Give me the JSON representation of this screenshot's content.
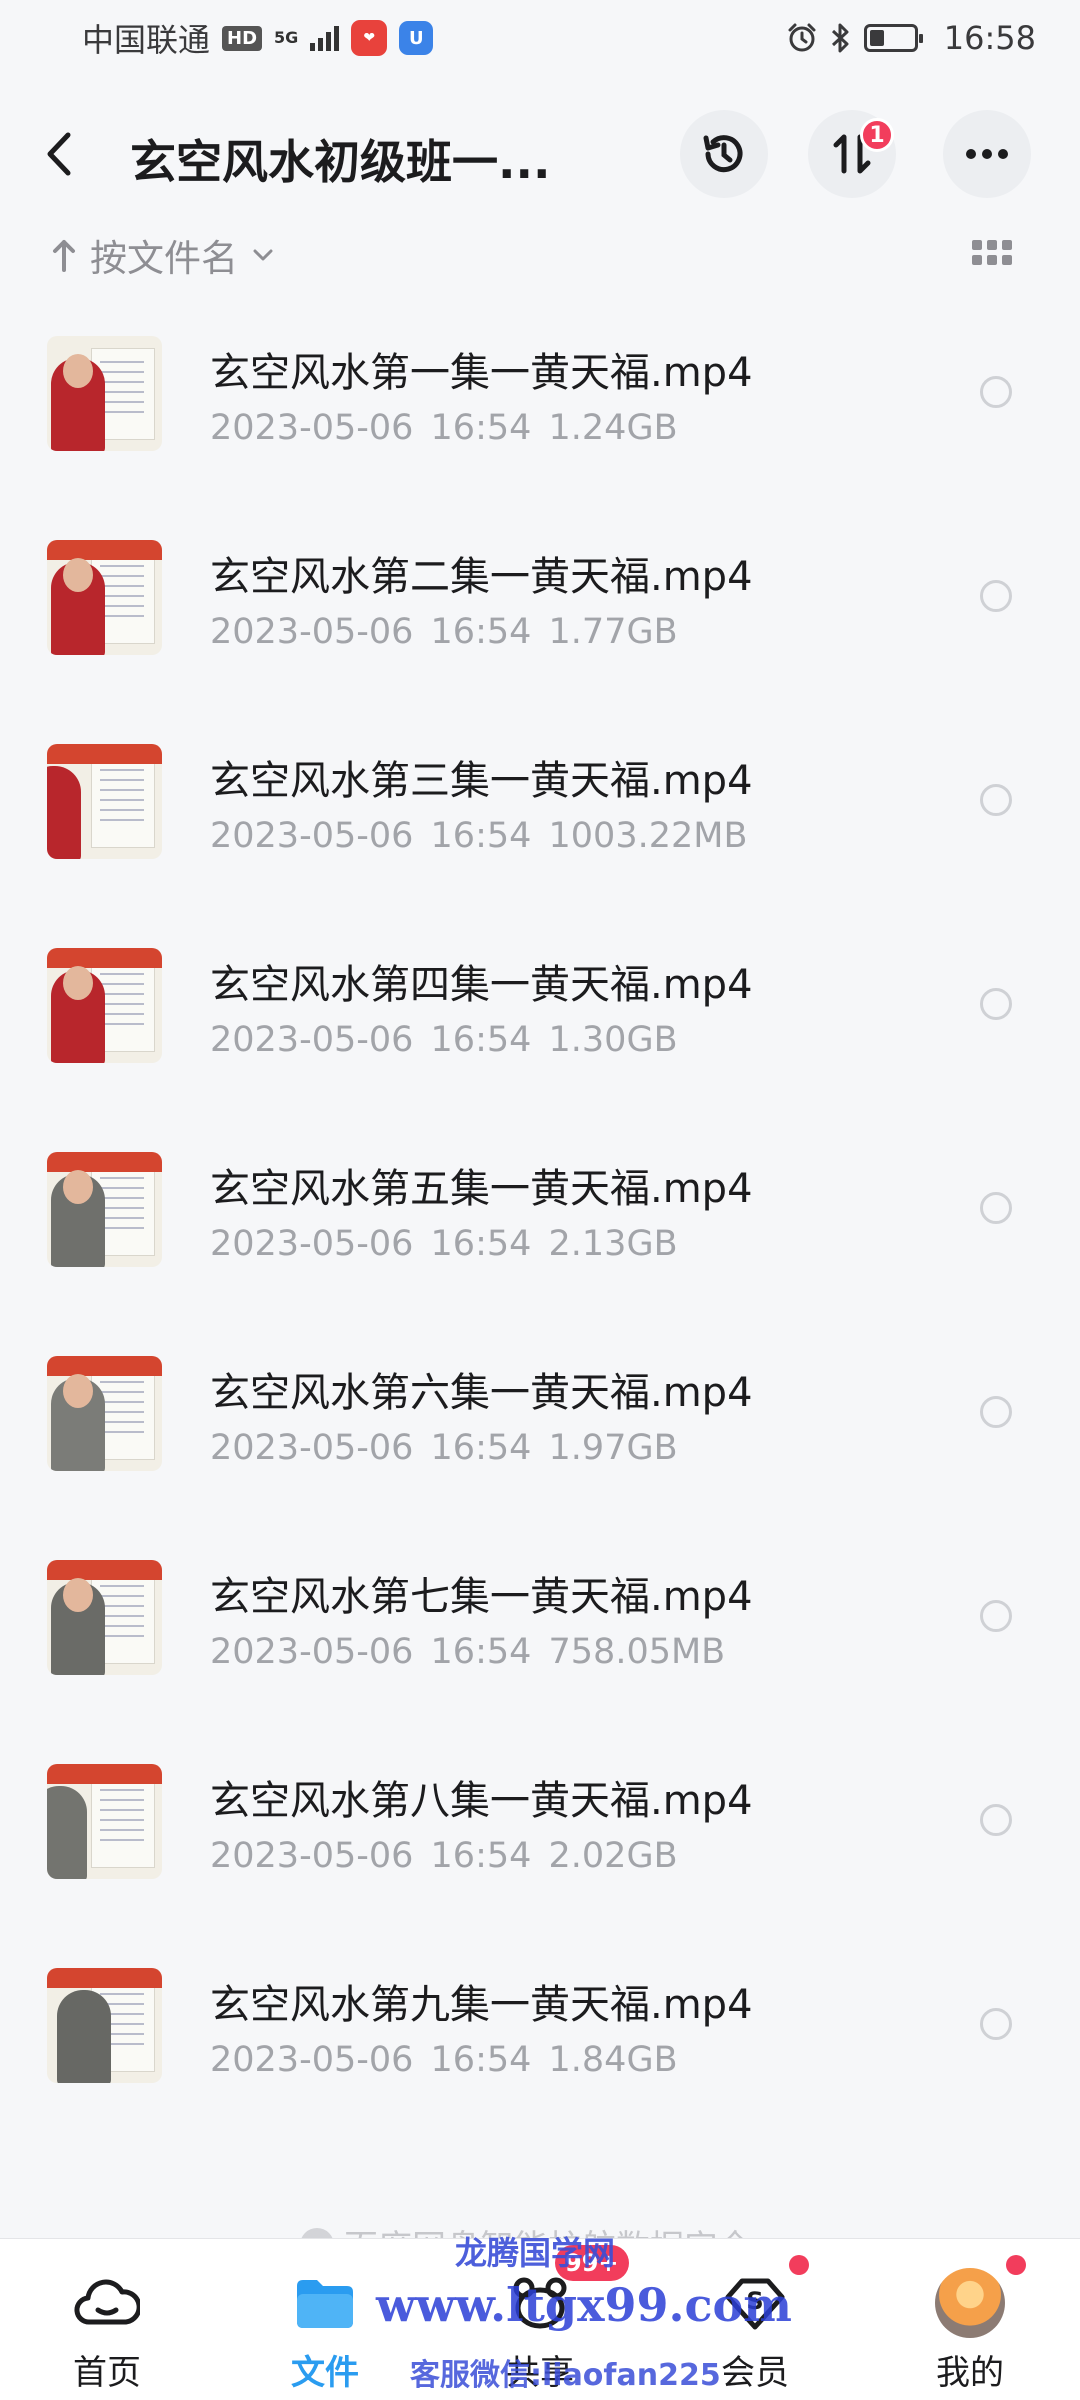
{
  "status_bar": {
    "carrier": "中国联通",
    "hd": "HD",
    "network": "5G",
    "time": "16:58"
  },
  "header": {
    "title": "玄空风水初级班一...",
    "transfer_badge": "1"
  },
  "sort": {
    "label": "按文件名"
  },
  "files": [
    {
      "name": "玄空风水第一集一黄天福.mp4",
      "meta": "2023-05-06  16:54  1.24GB"
    },
    {
      "name": "玄空风水第二集一黄天福.mp4",
      "meta": "2023-05-06  16:54  1.77GB"
    },
    {
      "name": "玄空风水第三集一黄天福.mp4",
      "meta": "2023-05-06  16:54  1003.22MB"
    },
    {
      "name": "玄空风水第四集一黄天福.mp4",
      "meta": "2023-05-06  16:54  1.30GB"
    },
    {
      "name": "玄空风水第五集一黄天福.mp4",
      "meta": "2023-05-06  16:54  2.13GB"
    },
    {
      "name": "玄空风水第六集一黄天福.mp4",
      "meta": "2023-05-06  16:54  1.97GB"
    },
    {
      "name": "玄空风水第七集一黄天福.mp4",
      "meta": "2023-05-06  16:54  758.05MB"
    },
    {
      "name": "玄空风水第八集一黄天福.mp4",
      "meta": "2023-05-06  16:54  2.02GB"
    },
    {
      "name": "玄空风水第九集一黄天福.mp4",
      "meta": "2023-05-06  16:54  1.84GB"
    }
  ],
  "footer_note": "百度网盘智能护航数据安全",
  "bottom_nav": {
    "home": "首页",
    "files": "文件",
    "share": "共享",
    "share_count": "99+",
    "vip": "会员",
    "me": "我的"
  },
  "watermark": {
    "line1": "龙腾国学网",
    "line2": "www.ltgx99.com",
    "line3": "客服微信:liaofan225"
  },
  "colors": {
    "accent": "#2a9cf0",
    "badge": "#f23d5c",
    "background": "#f6f7f9"
  }
}
